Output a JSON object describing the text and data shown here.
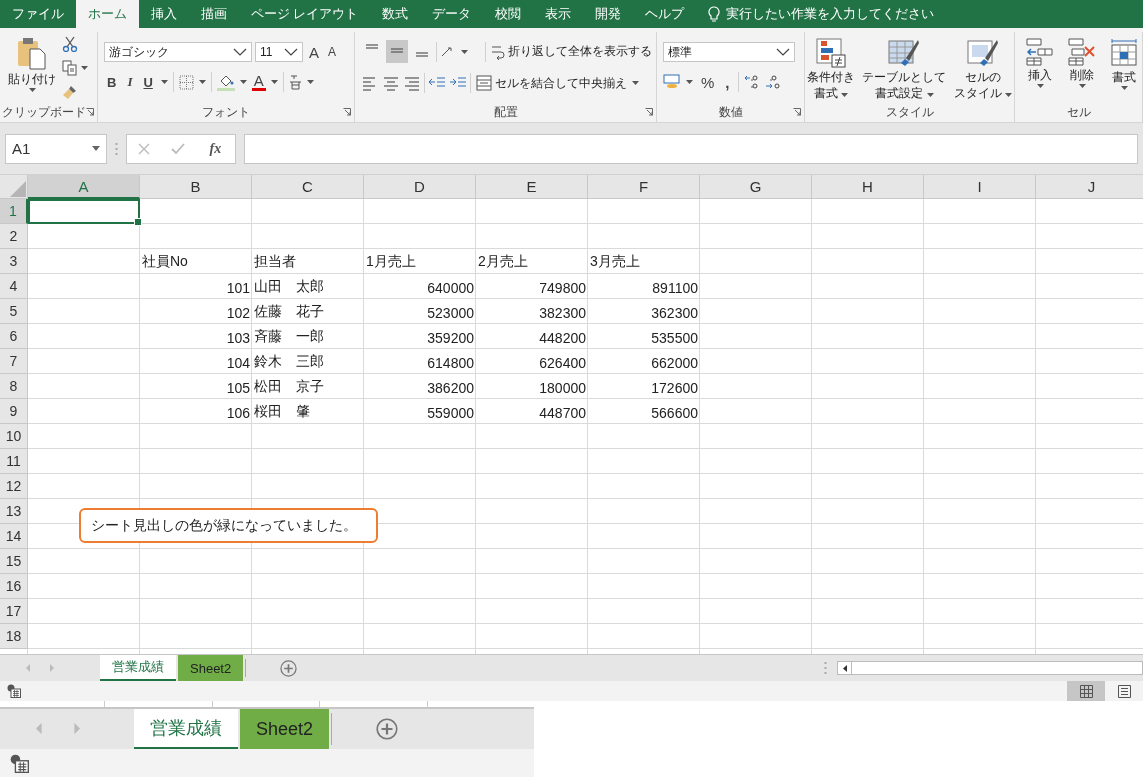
{
  "menu_tabs": [
    {
      "label": "ファイル",
      "selected": false
    },
    {
      "label": "ホーム",
      "selected": true
    },
    {
      "label": "挿入",
      "selected": false
    },
    {
      "label": "描画",
      "selected": false
    },
    {
      "label": "ページ レイアウト",
      "selected": false
    },
    {
      "label": "数式",
      "selected": false
    },
    {
      "label": "データ",
      "selected": false
    },
    {
      "label": "校閲",
      "selected": false
    },
    {
      "label": "表示",
      "selected": false
    },
    {
      "label": "開発",
      "selected": false
    },
    {
      "label": "ヘルプ",
      "selected": false
    }
  ],
  "tell_me": {
    "placeholder": "実行したい作業を入力してください"
  },
  "ribbon": {
    "groups": [
      {
        "kind": "clipboard",
        "label": "クリップボード",
        "launcher": true,
        "paste": "貼り付け"
      },
      {
        "kind": "font",
        "label": "フォント",
        "launcher": true,
        "font_name": "游ゴシック",
        "font_size": "11",
        "grow": "A",
        "shrink": "A",
        "bold": "B",
        "italic": "I",
        "underline": "U",
        "font_color": "A"
      },
      {
        "kind": "alignment",
        "label": "配置",
        "launcher": true,
        "vertical_align": [
          {
            "selected": false
          },
          {
            "selected": true
          },
          {
            "selected": false
          }
        ],
        "wrap": "折り返して全体を表示する",
        "merge": "セルを結合して中央揃え"
      },
      {
        "kind": "number",
        "label": "数値",
        "launcher": true,
        "format": "標準",
        "percent": "%",
        "comma": ","
      },
      {
        "kind": "styles",
        "label": "スタイル",
        "launcher": false,
        "buttons": [
          {
            "lines": [
              "条件付き",
              "書式"
            ]
          },
          {
            "lines": [
              "テーブルとして",
              "書式設定"
            ]
          },
          {
            "lines": [
              "セルの",
              "スタイル"
            ]
          }
        ]
      },
      {
        "kind": "cells",
        "label": "セル",
        "launcher": false,
        "buttons": [
          {
            "label": "挿入"
          },
          {
            "label": "削除"
          },
          {
            "label": "書式"
          }
        ]
      }
    ]
  },
  "formula_bar": {
    "name_box": "A1",
    "fx": "fx"
  },
  "sheet": {
    "columns": [
      {
        "label": "A",
        "selected": true
      },
      {
        "label": "B",
        "selected": false
      },
      {
        "label": "C",
        "selected": false
      },
      {
        "label": "D",
        "selected": false
      },
      {
        "label": "E",
        "selected": false
      },
      {
        "label": "F",
        "selected": false
      },
      {
        "label": "G",
        "selected": false
      },
      {
        "label": "H",
        "selected": false
      },
      {
        "label": "I",
        "selected": false
      },
      {
        "label": "J",
        "selected": false
      }
    ],
    "rows": [
      {
        "label": "1",
        "selected": true
      },
      {
        "label": "2",
        "selected": false
      },
      {
        "label": "3",
        "selected": false
      },
      {
        "label": "4",
        "selected": false
      },
      {
        "label": "5",
        "selected": false
      },
      {
        "label": "6",
        "selected": false
      },
      {
        "label": "7",
        "selected": false
      },
      {
        "label": "8",
        "selected": false
      },
      {
        "label": "9",
        "selected": false
      },
      {
        "label": "10",
        "selected": false
      },
      {
        "label": "11",
        "selected": false
      },
      {
        "label": "12",
        "selected": false
      },
      {
        "label": "13",
        "selected": false
      },
      {
        "label": "14",
        "selected": false
      },
      {
        "label": "15",
        "selected": false
      },
      {
        "label": "16",
        "selected": false
      },
      {
        "label": "17",
        "selected": false
      },
      {
        "label": "18",
        "selected": false
      }
    ],
    "table": {
      "headers": [
        "社員No",
        "担当者",
        "1月売上",
        "2月売上",
        "3月売上"
      ],
      "rows": [
        {
          "no": "101",
          "name": "山田　太郎",
          "jan": "640000",
          "feb": "749800",
          "mar": "891100"
        },
        {
          "no": "102",
          "name": "佐藤　花子",
          "jan": "523000",
          "feb": "382300",
          "mar": "362300"
        },
        {
          "no": "103",
          "name": "斉藤　一郎",
          "jan": "359200",
          "feb": "448200",
          "mar": "535500"
        },
        {
          "no": "104",
          "name": "鈴木　三郎",
          "jan": "614800",
          "feb": "626400",
          "mar": "662000"
        },
        {
          "no": "105",
          "name": "松田　京子",
          "jan": "386200",
          "feb": "180000",
          "mar": "172600"
        },
        {
          "no": "106",
          "name": "桜田　肇",
          "jan": "559000",
          "feb": "448700",
          "mar": "566600"
        }
      ]
    },
    "callout": "シート見出しの色が緑になっていました。"
  },
  "sheet_tabs": [
    {
      "label": "営業成績",
      "selected": true
    },
    {
      "label": "Sheet2",
      "selected": false,
      "color": "#70ad47"
    }
  ],
  "zoomed_sheet_tabs": [
    {
      "label": "営業成績",
      "selected": true
    },
    {
      "label": "Sheet2",
      "selected": false,
      "color": "#70ad47"
    }
  ]
}
